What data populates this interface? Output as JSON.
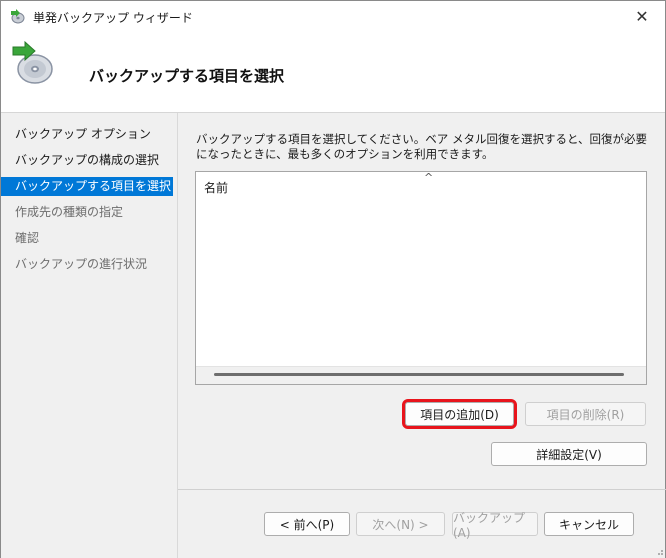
{
  "window": {
    "title": "単発バックアップ ウィザード",
    "close_glyph": "✕"
  },
  "header": {
    "title": "バックアップする項目を選択"
  },
  "sidebar": {
    "steps": [
      {
        "label": "バックアップ オプション",
        "state": "done"
      },
      {
        "label": "バックアップの構成の選択",
        "state": "done"
      },
      {
        "label": "バックアップする項目を選択",
        "state": "active"
      },
      {
        "label": "作成先の種類の指定",
        "state": "future"
      },
      {
        "label": "確認",
        "state": "future"
      },
      {
        "label": "バックアップの進行状況",
        "state": "future"
      }
    ]
  },
  "content": {
    "instruction": "バックアップする項目を選択してください。ベア メタル回復を選択すると、回復が必要になったときに、最も多くのオプションを利用できます。",
    "list": {
      "column_header": "名前",
      "sort_glyph": "^",
      "items": []
    },
    "add_items_label": "項目の追加(D)",
    "remove_items_label": "項目の削除(R)",
    "advanced_settings_label": "詳細設定(V)"
  },
  "footer": {
    "back_label": "< 前へ(P)",
    "next_label": "次へ(N) >",
    "backup_label": "バックアップ(A)",
    "cancel_label": "キャンセル"
  },
  "colors": {
    "accent": "#0078d7",
    "highlight_box": "#e8141c"
  }
}
